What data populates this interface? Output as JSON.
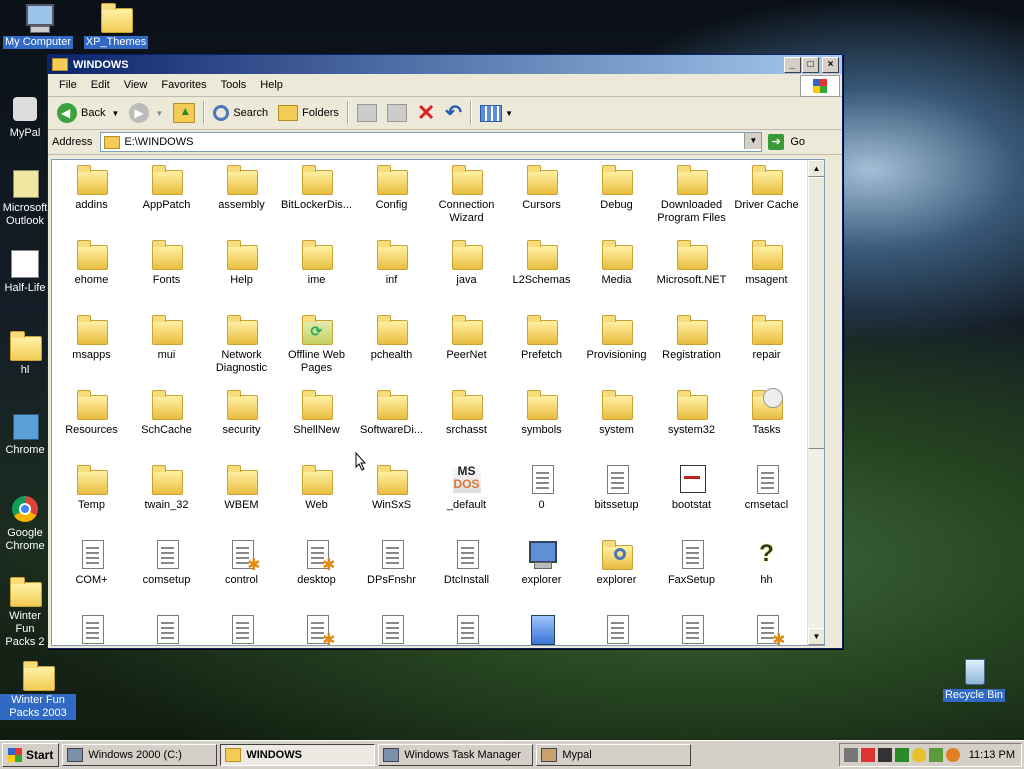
{
  "desktop": {
    "icons": [
      {
        "label": "My Computer"
      },
      {
        "label": "XP_Themes"
      },
      {
        "label": "MyPal"
      },
      {
        "label": "Microsoft Outlook"
      },
      {
        "label": "Half-Life"
      },
      {
        "label": "hl"
      },
      {
        "label": "Chrome"
      },
      {
        "label": "Google Chrome"
      },
      {
        "label": "Winter Fun Packs 2"
      },
      {
        "label": "Winter Fun Packs 2003"
      },
      {
        "label": "Recycle Bin"
      }
    ]
  },
  "window": {
    "title": "WINDOWS",
    "menu": [
      "File",
      "Edit",
      "View",
      "Favorites",
      "Tools",
      "Help"
    ],
    "toolbar": {
      "back": "Back",
      "search": "Search",
      "folders": "Folders"
    },
    "address": {
      "label": "Address",
      "value": "E:\\WINDOWS",
      "go": "Go"
    },
    "items": [
      {
        "name": "addins",
        "icon": "folder"
      },
      {
        "name": "AppPatch",
        "icon": "folder"
      },
      {
        "name": "assembly",
        "icon": "folder"
      },
      {
        "name": "BitLockerDis...",
        "icon": "folder"
      },
      {
        "name": "Config",
        "icon": "folder"
      },
      {
        "name": "Connection Wizard",
        "icon": "folder"
      },
      {
        "name": "Cursors",
        "icon": "folder"
      },
      {
        "name": "Debug",
        "icon": "folder"
      },
      {
        "name": "Downloaded Program Files",
        "icon": "folder"
      },
      {
        "name": "Driver Cache",
        "icon": "folder"
      },
      {
        "name": "ehome",
        "icon": "folder"
      },
      {
        "name": "Fonts",
        "icon": "folder"
      },
      {
        "name": "Help",
        "icon": "folder"
      },
      {
        "name": "ime",
        "icon": "folder"
      },
      {
        "name": "inf",
        "icon": "folder"
      },
      {
        "name": "java",
        "icon": "folder"
      },
      {
        "name": "L2Schemas",
        "icon": "folder"
      },
      {
        "name": "Media",
        "icon": "folder"
      },
      {
        "name": "Microsoft.NET",
        "icon": "folder"
      },
      {
        "name": "msagent",
        "icon": "folder"
      },
      {
        "name": "msapps",
        "icon": "folder"
      },
      {
        "name": "mui",
        "icon": "folder"
      },
      {
        "name": "Network Diagnostic",
        "icon": "folder"
      },
      {
        "name": "Offline Web Pages",
        "icon": "offline"
      },
      {
        "name": "pchealth",
        "icon": "folder"
      },
      {
        "name": "PeerNet",
        "icon": "folder"
      },
      {
        "name": "Prefetch",
        "icon": "folder"
      },
      {
        "name": "Provisioning",
        "icon": "folder"
      },
      {
        "name": "Registration",
        "icon": "folder"
      },
      {
        "name": "repair",
        "icon": "folder"
      },
      {
        "name": "Resources",
        "icon": "folder"
      },
      {
        "name": "SchCache",
        "icon": "folder"
      },
      {
        "name": "security",
        "icon": "folder"
      },
      {
        "name": "ShellNew",
        "icon": "folder"
      },
      {
        "name": "SoftwareDi...",
        "icon": "folder"
      },
      {
        "name": "srchasst",
        "icon": "folder"
      },
      {
        "name": "symbols",
        "icon": "folder"
      },
      {
        "name": "system",
        "icon": "folder"
      },
      {
        "name": "system32",
        "icon": "folder"
      },
      {
        "name": "Tasks",
        "icon": "tasks"
      },
      {
        "name": "Temp",
        "icon": "folder"
      },
      {
        "name": "twain_32",
        "icon": "folder"
      },
      {
        "name": "WBEM",
        "icon": "folder"
      },
      {
        "name": "Web",
        "icon": "folder"
      },
      {
        "name": "WinSxS",
        "icon": "folder"
      },
      {
        "name": "_default",
        "icon": "msdos"
      },
      {
        "name": "0",
        "icon": "doc"
      },
      {
        "name": "bitssetup",
        "icon": "doc"
      },
      {
        "name": "bootstat",
        "icon": "app"
      },
      {
        "name": "cmsetacl",
        "icon": "doc"
      },
      {
        "name": "COM+",
        "icon": "doc"
      },
      {
        "name": "comsetup",
        "icon": "doc"
      },
      {
        "name": "control",
        "icon": "gear"
      },
      {
        "name": "desktop",
        "icon": "gear"
      },
      {
        "name": "DPsFnshr",
        "icon": "doc"
      },
      {
        "name": "DtcInstall",
        "icon": "doc"
      },
      {
        "name": "explorer",
        "icon": "computer"
      },
      {
        "name": "explorer",
        "icon": "search"
      },
      {
        "name": "FaxSetup",
        "icon": "doc"
      },
      {
        "name": "hh",
        "icon": "help"
      },
      {
        "name": "",
        "icon": "doc"
      },
      {
        "name": "",
        "icon": "doc"
      },
      {
        "name": "",
        "icon": "doc"
      },
      {
        "name": "",
        "icon": "gear"
      },
      {
        "name": "",
        "icon": "doc"
      },
      {
        "name": "",
        "icon": "doc"
      },
      {
        "name": "",
        "icon": "notepad"
      },
      {
        "name": "",
        "icon": "doc"
      },
      {
        "name": "",
        "icon": "doc"
      },
      {
        "name": "",
        "icon": "gear"
      }
    ]
  },
  "taskbar": {
    "start": "Start",
    "tasks": [
      {
        "label": "Windows 2000 (C:)",
        "active": false
      },
      {
        "label": "WINDOWS",
        "active": true
      },
      {
        "label": "Windows Task Manager",
        "active": false
      },
      {
        "label": "Mypal",
        "active": false
      }
    ],
    "clock": "11:13 PM"
  }
}
